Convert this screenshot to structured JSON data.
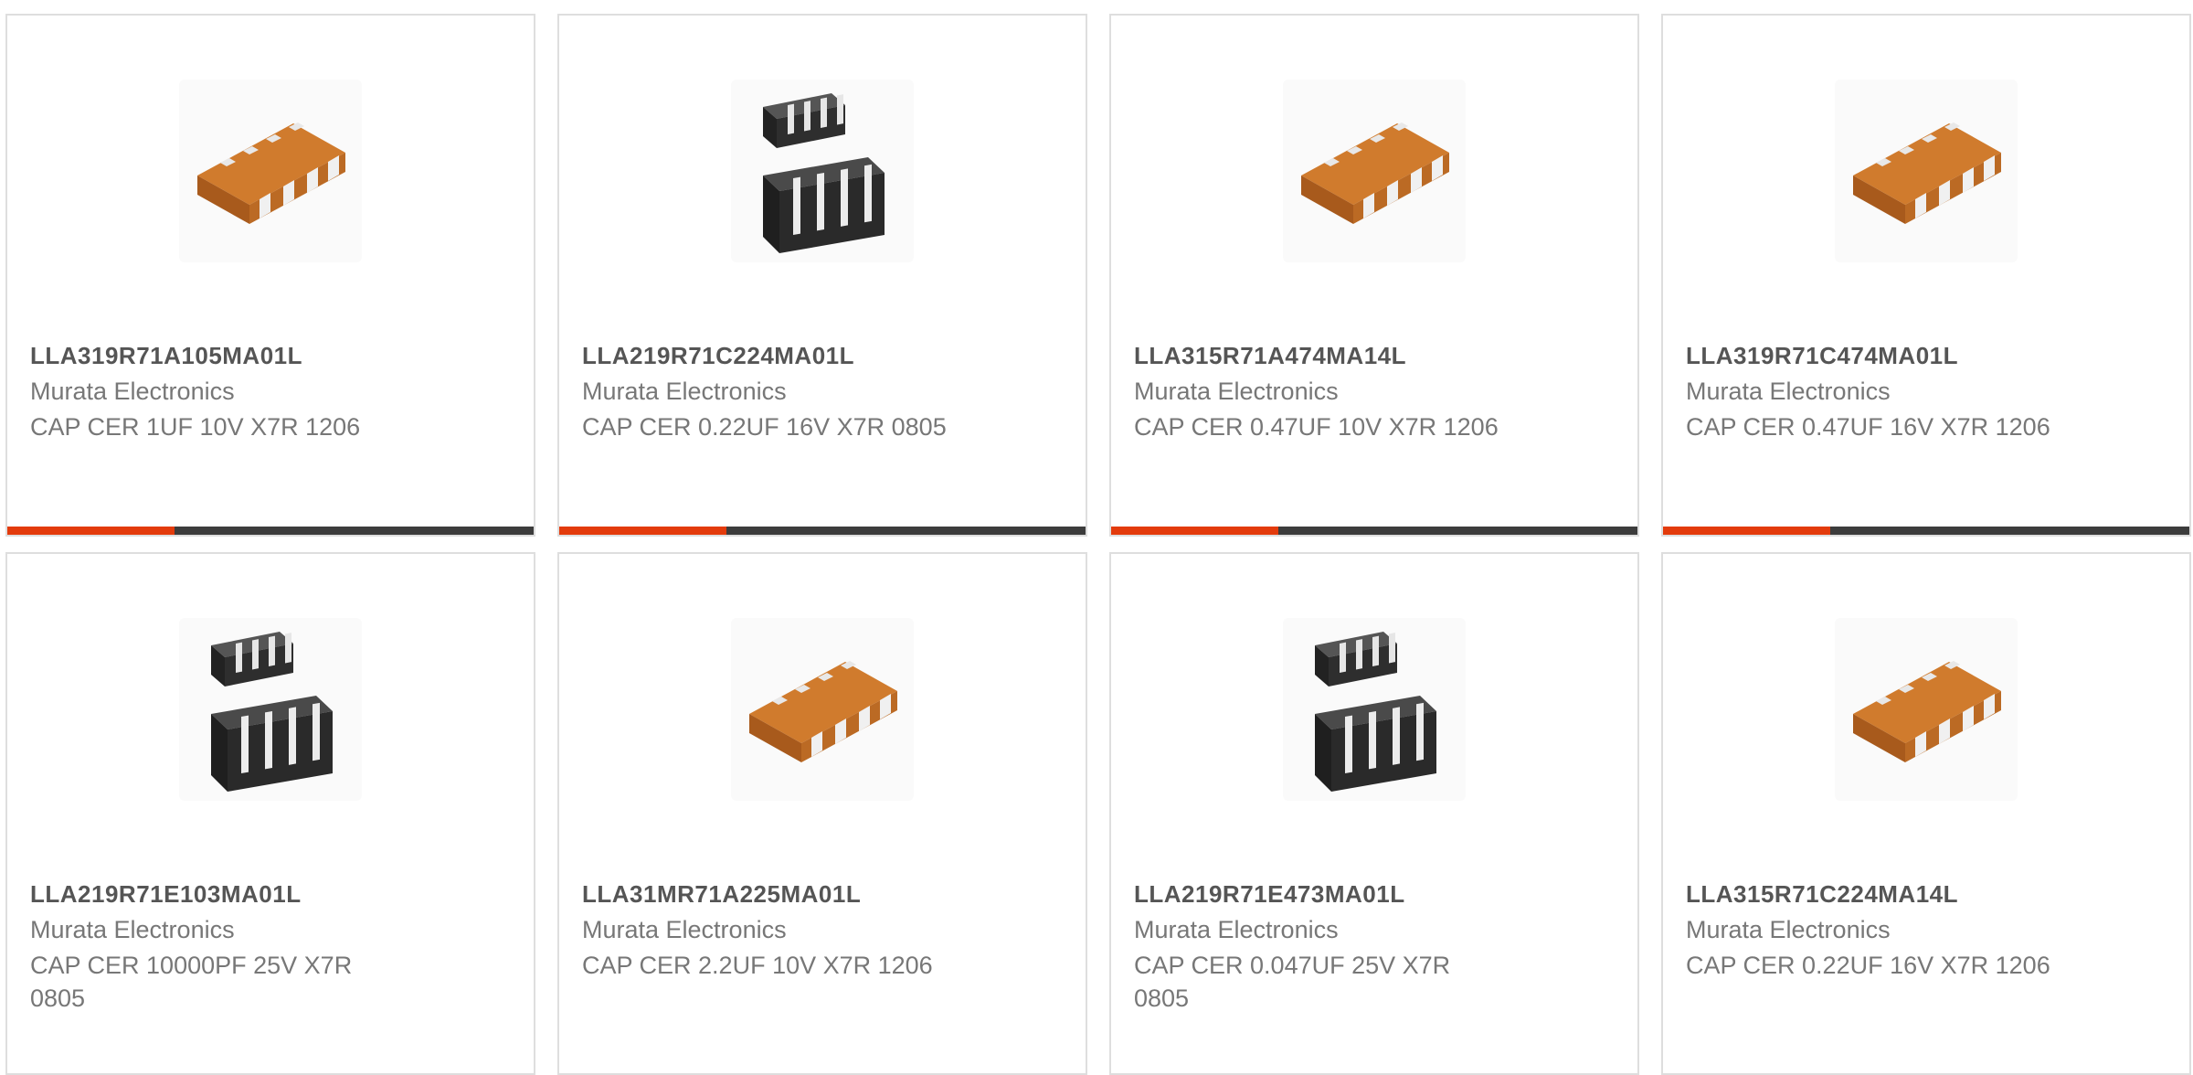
{
  "products": [
    {
      "part_number": "LLA319R71A105MA01L",
      "manufacturer": "Murata Electronics",
      "description": "CAP CER 1UF 10V X7R 1206",
      "image_icon": "orange-array-capacitor-icon"
    },
    {
      "part_number": "LLA219R71C224MA01L",
      "manufacturer": "Murata Electronics",
      "description": "CAP CER 0.22UF 16V X7R 0805",
      "image_icon": "black-array-capacitor-icon"
    },
    {
      "part_number": "LLA315R71A474MA14L",
      "manufacturer": "Murata Electronics",
      "description": "CAP CER 0.47UF 10V X7R 1206",
      "image_icon": "orange-array-capacitor-icon"
    },
    {
      "part_number": "LLA319R71C474MA01L",
      "manufacturer": "Murata Electronics",
      "description": "CAP CER 0.47UF 16V X7R 1206",
      "image_icon": "orange-array-capacitor-icon"
    },
    {
      "part_number": "LLA219R71E103MA01L",
      "manufacturer": "Murata Electronics",
      "description": "CAP CER 10000PF 25V X7R 0805",
      "image_icon": "black-array-capacitor-icon"
    },
    {
      "part_number": "LLA31MR71A225MA01L",
      "manufacturer": "Murata Electronics",
      "description": "CAP CER 2.2UF 10V X7R 1206",
      "image_icon": "orange-array-capacitor-icon"
    },
    {
      "part_number": "LLA219R71E473MA01L",
      "manufacturer": "Murata Electronics",
      "description": "CAP CER 0.047UF 25V X7R 0805",
      "image_icon": "black-array-capacitor-icon"
    },
    {
      "part_number": "LLA315R71C224MA14L",
      "manufacturer": "Murata Electronics",
      "description": "CAP CER 0.22UF 16V X7R 1206",
      "image_icon": "orange-array-capacitor-icon"
    }
  ],
  "colors": {
    "accent": "#e33b0c",
    "bar": "#3c3c3c",
    "part_number_text": "#555555",
    "secondary_text": "#777777",
    "card_border": "#dedede"
  }
}
